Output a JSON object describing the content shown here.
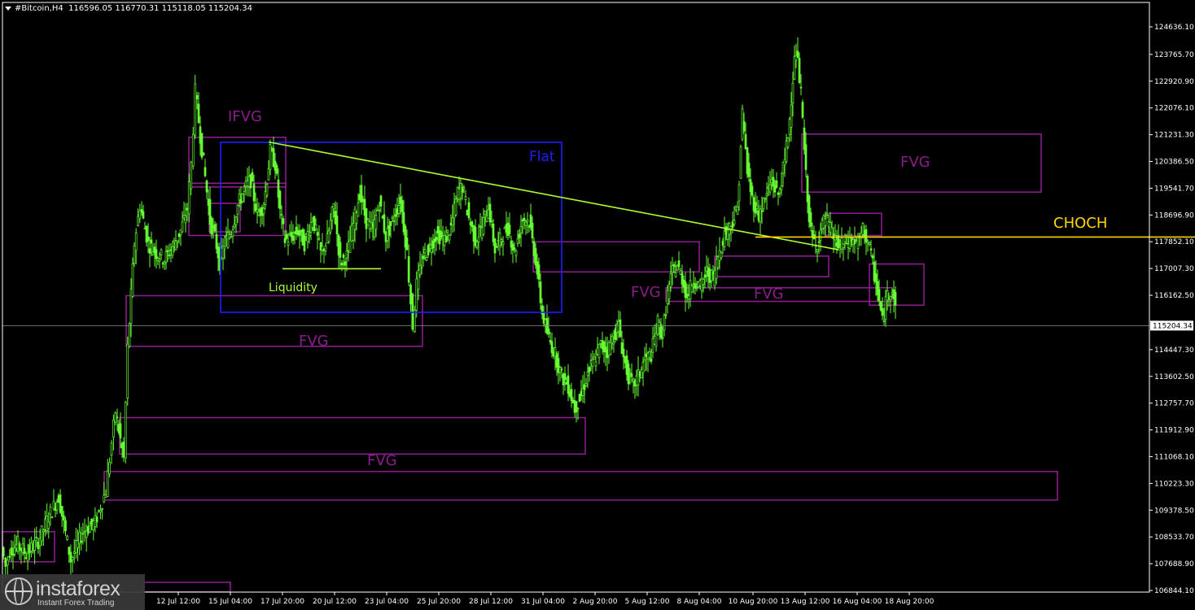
{
  "header": {
    "symbol": "#Bitcoin,H4",
    "ohlc": "116596.05 116770.31 115118.05 115204.34"
  },
  "chart_data": {
    "type": "candlestick",
    "title": "",
    "ylim": [
      106500,
      125000
    ],
    "price_ticks": [
      "124636.10",
      "123765.70",
      "122920.90",
      "122076.10",
      "121231.30",
      "120386.50",
      "119541.70",
      "118696.90",
      "117852.10",
      "117007.30",
      "116162.50",
      "115204.34",
      "114447.30",
      "113602.50",
      "112757.70",
      "111912.90",
      "111068.10",
      "110223.30",
      "109378.50",
      "108533.70",
      "107688.90",
      "106844.10"
    ],
    "current_price": 115204.34,
    "time_labels": [
      "12 Jul 12:00",
      "15 Jul 04:00",
      "17 Jul 20:00",
      "20 Jul 12:00",
      "23 Jul 04:00",
      "25 Jul 20:00",
      "28 Jul 12:00",
      "31 Jul 04:00",
      "2 Aug 20:00",
      "5 Aug 12:00",
      "8 Aug 04:00",
      "10 Aug 20:00",
      "13 Aug 12:00",
      "16 Aug 04:00",
      "18 Aug 20:00"
    ],
    "price_path": [
      [
        0,
        108200
      ],
      [
        5,
        107600
      ],
      [
        10,
        108100
      ],
      [
        20,
        108300
      ],
      [
        30,
        108000
      ],
      [
        45,
        108400
      ],
      [
        60,
        109300
      ],
      [
        70,
        109800
      ],
      [
        85,
        107800
      ],
      [
        100,
        108700
      ],
      [
        115,
        109000
      ],
      [
        128,
        110000
      ],
      [
        140,
        112500
      ],
      [
        150,
        111000
      ],
      [
        155,
        114500
      ],
      [
        163,
        117800
      ],
      [
        170,
        119000
      ],
      [
        180,
        117800
      ],
      [
        190,
        117500
      ],
      [
        200,
        117300
      ],
      [
        210,
        117700
      ],
      [
        220,
        118200
      ],
      [
        228,
        118900
      ],
      [
        233,
        120300
      ],
      [
        238,
        122600
      ],
      [
        244,
        121200
      ],
      [
        250,
        119900
      ],
      [
        256,
        118500
      ],
      [
        262,
        118000
      ],
      [
        268,
        117200
      ],
      [
        274,
        117800
      ],
      [
        282,
        118200
      ],
      [
        290,
        119000
      ],
      [
        298,
        119500
      ],
      [
        306,
        119800
      ],
      [
        314,
        118700
      ],
      [
        322,
        119000
      ],
      [
        330,
        120700
      ],
      [
        336,
        120300
      ],
      [
        342,
        118800
      ],
      [
        348,
        117900
      ],
      [
        356,
        118000
      ],
      [
        364,
        118200
      ],
      [
        372,
        117800
      ],
      [
        382,
        118600
      ],
      [
        392,
        117500
      ],
      [
        400,
        117900
      ],
      [
        408,
        119000
      ],
      [
        416,
        117200
      ],
      [
        424,
        117400
      ],
      [
        432,
        118400
      ],
      [
        440,
        119400
      ],
      [
        448,
        118500
      ],
      [
        456,
        118200
      ],
      [
        464,
        119100
      ],
      [
        472,
        118000
      ],
      [
        480,
        118500
      ],
      [
        490,
        119200
      ],
      [
        498,
        117500
      ],
      [
        505,
        115200
      ],
      [
        510,
        116500
      ],
      [
        518,
        117400
      ],
      [
        526,
        117700
      ],
      [
        534,
        118100
      ],
      [
        544,
        117900
      ],
      [
        552,
        118300
      ],
      [
        560,
        119400
      ],
      [
        566,
        119600
      ],
      [
        574,
        118600
      ],
      [
        582,
        117900
      ],
      [
        590,
        118300
      ],
      [
        598,
        119000
      ],
      [
        606,
        117600
      ],
      [
        614,
        118000
      ],
      [
        622,
        118300
      ],
      [
        630,
        117500
      ],
      [
        640,
        118600
      ],
      [
        648,
        118500
      ],
      [
        656,
        117300
      ],
      [
        664,
        115600
      ],
      [
        672,
        114800
      ],
      [
        680,
        114300
      ],
      [
        688,
        113600
      ],
      [
        696,
        113300
      ],
      [
        704,
        112600
      ],
      [
        712,
        113000
      ],
      [
        720,
        113700
      ],
      [
        728,
        114100
      ],
      [
        736,
        114600
      ],
      [
        744,
        114400
      ],
      [
        752,
        114900
      ],
      [
        758,
        115200
      ],
      [
        764,
        114200
      ],
      [
        770,
        113600
      ],
      [
        776,
        113300
      ],
      [
        782,
        113600
      ],
      [
        790,
        114100
      ],
      [
        798,
        114300
      ],
      [
        806,
        115300
      ],
      [
        812,
        114900
      ],
      [
        818,
        116200
      ],
      [
        824,
        116900
      ],
      [
        830,
        117100
      ],
      [
        836,
        116700
      ],
      [
        842,
        116100
      ],
      [
        850,
        116700
      ],
      [
        858,
        116400
      ],
      [
        866,
        116900
      ],
      [
        874,
        116700
      ],
      [
        880,
        117400
      ],
      [
        888,
        118100
      ],
      [
        896,
        118400
      ],
      [
        904,
        118900
      ],
      [
        910,
        121900
      ],
      [
        916,
        120100
      ],
      [
        922,
        119200
      ],
      [
        930,
        118700
      ],
      [
        938,
        119200
      ],
      [
        946,
        119800
      ],
      [
        954,
        119300
      ],
      [
        962,
        120400
      ],
      [
        968,
        121700
      ],
      [
        972,
        123100
      ],
      [
        976,
        123900
      ],
      [
        982,
        122500
      ],
      [
        988,
        119900
      ],
      [
        994,
        118100
      ],
      [
        1000,
        117700
      ],
      [
        1006,
        118200
      ],
      [
        1012,
        118600
      ],
      [
        1020,
        118100
      ],
      [
        1028,
        117700
      ],
      [
        1036,
        117800
      ],
      [
        1044,
        117900
      ],
      [
        1052,
        117800
      ],
      [
        1058,
        118200
      ],
      [
        1064,
        117900
      ],
      [
        1070,
        117100
      ],
      [
        1076,
        116300
      ],
      [
        1082,
        115300
      ],
      [
        1088,
        116200
      ],
      [
        1094,
        116400
      ],
      [
        1100,
        115400
      ]
    ],
    "zones": [
      {
        "label": "FVG",
        "top": 119700,
        "bottom": 118050
      },
      {
        "label": "IFVG",
        "top": 121150,
        "bottom": 119580
      },
      {
        "label": "FVG",
        "top": 116150,
        "bottom": 114550
      },
      {
        "label": "FVG",
        "top": 112300,
        "bottom": 111150
      },
      {
        "label": "FVG",
        "top": 110600,
        "bottom": 109700
      },
      {
        "label": "FVG",
        "top": 117850,
        "bottom": 116900
      },
      {
        "label": "FVG",
        "top": 117400,
        "bottom": 116750
      },
      {
        "label": "FVG",
        "top": 116400,
        "bottom": 115970
      },
      {
        "label": "FVG",
        "top": 121250,
        "bottom": 119420
      },
      {
        "label": "",
        "top": 118750,
        "bottom": 118050
      },
      {
        "label": "",
        "top": 117150,
        "bottom": 115850
      },
      {
        "label": "",
        "top": 108700,
        "bottom": 107750
      },
      {
        "label": "",
        "top": 107100,
        "bottom": 106800
      }
    ],
    "labels": {
      "flat": "Flat",
      "liquidity": "Liquidity",
      "choch": "CHOCH",
      "ifvg": "IFVG",
      "fvg": "FVG"
    },
    "choch_price": 118000,
    "liquidity_price": 117000,
    "trendline": [
      [
        330,
        121000
      ],
      [
        1030,
        117600
      ]
    ],
    "colors": {
      "background": "#000000",
      "candle": "#66ff33",
      "zone": "#8b1c8b",
      "zone_text": "#8b1c8b",
      "flat_box": "#1f1fff",
      "trendline": "#adff2f",
      "choch": "#ffd700",
      "liquidity": "#adff2f",
      "axis_text": "#ffffff",
      "price_line": "#8a8a8a"
    }
  },
  "watermark": {
    "brand": "instaforex",
    "tagline": "Instant Forex Trading"
  }
}
